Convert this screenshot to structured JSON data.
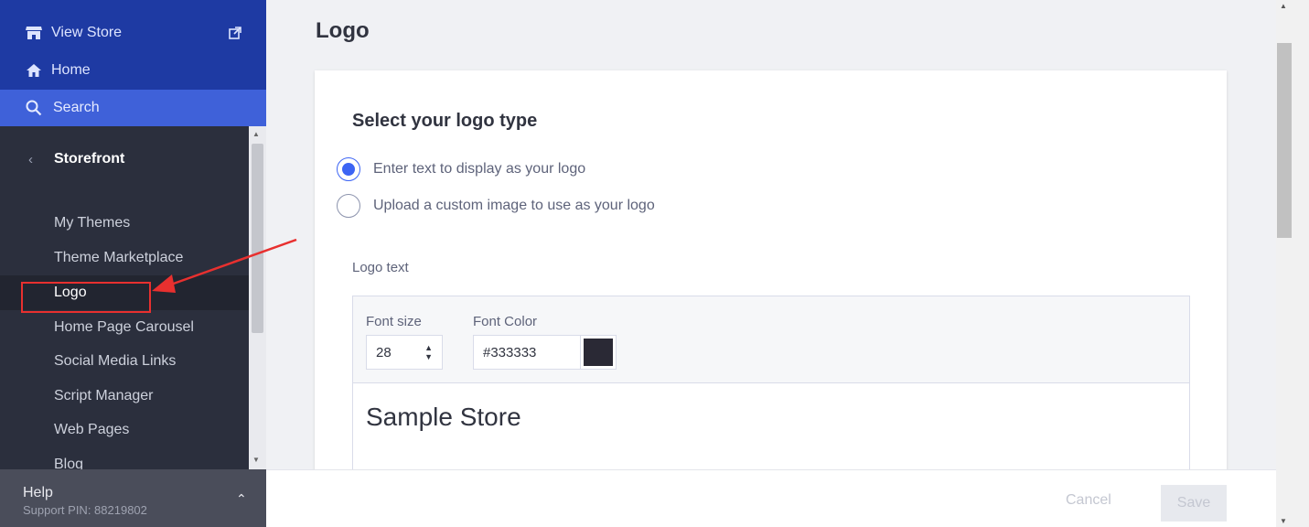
{
  "sidebar": {
    "view_store": "View Store",
    "home": "Home",
    "search": "Search",
    "section": "Storefront",
    "items": [
      {
        "label": "My Themes"
      },
      {
        "label": "Theme Marketplace"
      },
      {
        "label": "Logo"
      },
      {
        "label": "Home Page Carousel"
      },
      {
        "label": "Social Media Links"
      },
      {
        "label": "Script Manager"
      },
      {
        "label": "Web Pages"
      },
      {
        "label": "Blog"
      }
    ],
    "help_title": "Help",
    "support_pin": "Support PIN: 88219802"
  },
  "main": {
    "page_title": "Logo",
    "card_title": "Select your logo type",
    "radio_text": "Enter text to display as your logo",
    "radio_image": "Upload a custom image to use as your logo",
    "logo_text_label": "Logo text",
    "font_size_label": "Font size",
    "font_size_value": "28",
    "font_color_label": "Font Color",
    "font_color_value": "#333333",
    "preview_text": "Sample Store"
  },
  "footer": {
    "cancel": "Cancel",
    "save": "Save"
  },
  "colors": {
    "sidebar_top": "#1e3aa3",
    "search_bar": "#3f61d9",
    "sidebar_bg": "#2b2f3d",
    "accent": "#3c64f4",
    "annotation": "#e8302f",
    "swatch": "#2a2935"
  }
}
